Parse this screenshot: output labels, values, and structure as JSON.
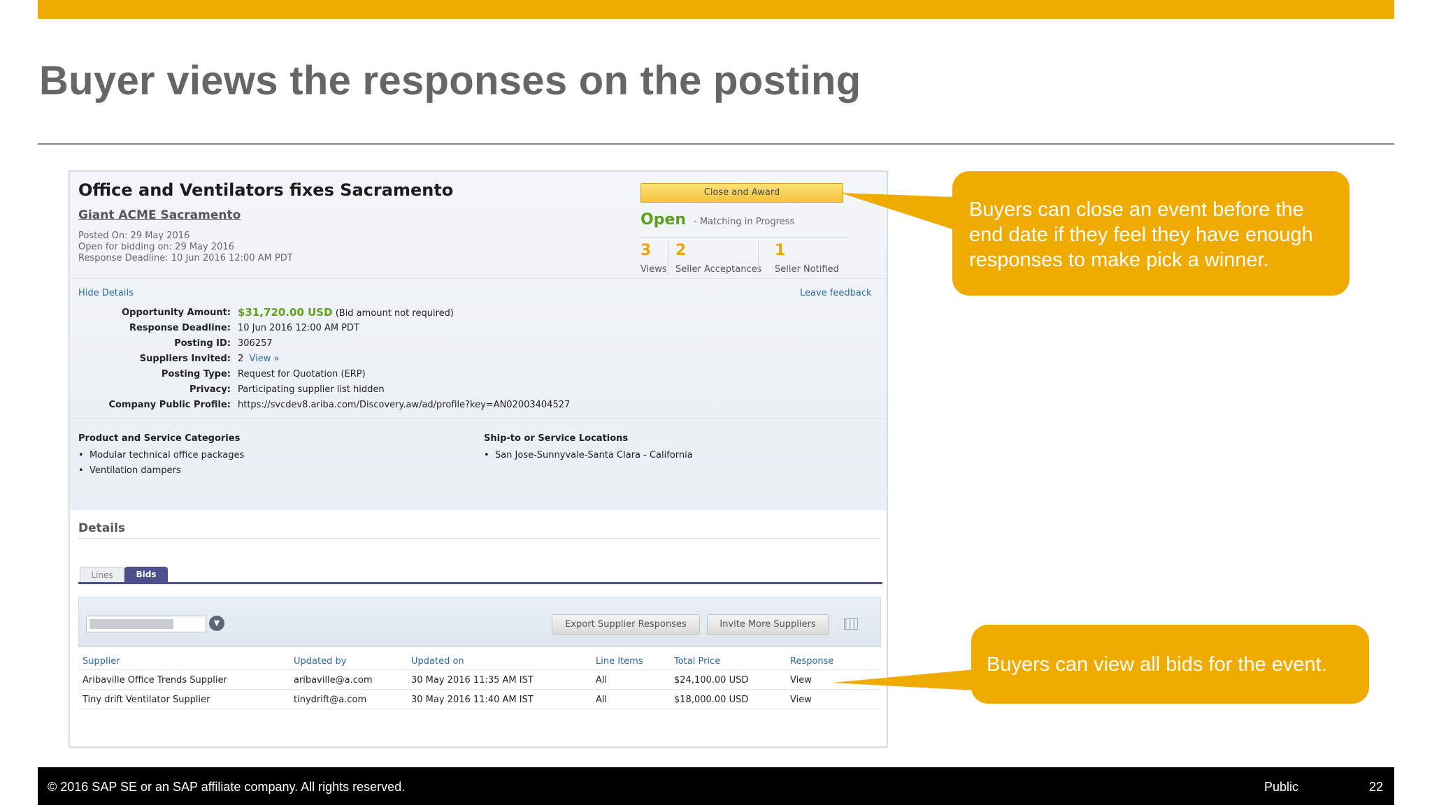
{
  "slide": {
    "title": "Buyer views the responses on the posting",
    "accent_color": "#f0ab00"
  },
  "event": {
    "title": "Office and Ventilators fixes Sacramento",
    "buyer": "Giant ACME Sacramento",
    "posted_on": "Posted On: 29 May 2016",
    "open_for_bidding": "Open for bidding on: 29 May 2016",
    "response_deadline_meta": "Response Deadline: 10 Jun 2016 12:00 AM PDT",
    "close_award_button": "Close and Award",
    "status": "Open",
    "status_sub": "- Matching in Progress",
    "stats": [
      {
        "num": "3",
        "label": "Views"
      },
      {
        "num": "2",
        "label": "Seller Acceptances"
      },
      {
        "num": "1",
        "label": "Seller Notified"
      }
    ],
    "hide_details_link": "Hide Details",
    "leave_feedback_link": "Leave feedback",
    "fields": {
      "opportunity_amount_label": "Opportunity Amount:",
      "opportunity_amount_value": "$31,720.00 USD",
      "opportunity_amount_note": "(Bid amount not required)",
      "response_deadline_label": "Response Deadline:",
      "response_deadline_value": "10 Jun 2016 12:00 AM PDT",
      "posting_id_label": "Posting ID:",
      "posting_id_value": "306257",
      "suppliers_invited_label": "Suppliers Invited:",
      "suppliers_invited_value": "2",
      "suppliers_invited_link": "View »",
      "posting_type_label": "Posting Type:",
      "posting_type_value": "Request for Quotation  (ERP)",
      "privacy_label": "Privacy:",
      "privacy_value": "Participating supplier list hidden",
      "company_profile_label": "Company Public Profile:",
      "company_profile_value": "https://svcdev8.ariba.com/Discovery.aw/ad/profile?key=AN02003404527"
    },
    "categories_heading": "Product and Service Categories",
    "categories": [
      "Modular technical office packages",
      "Ventilation dampers"
    ],
    "locations_heading": "Ship-to or Service Locations",
    "locations": [
      "San Jose-Sunnyvale-Santa Clara - California"
    ]
  },
  "details": {
    "heading": "Details",
    "tabs": [
      "Lines",
      "Bids"
    ],
    "active_tab": "Bids",
    "export_button": "Export Supplier Responses",
    "invite_button": "Invite More Suppliers",
    "columns": [
      "Supplier",
      "Updated by",
      "Updated on",
      "Line Items",
      "Total Price",
      "Response"
    ],
    "rows": [
      {
        "supplier": "Aribaville Office Trends Supplier",
        "updated_by": "aribaville@a.com",
        "updated_on": "30 May 2016 11:35 AM IST",
        "line_items": "All",
        "total_price": "$24,100.00 USD",
        "response": "View"
      },
      {
        "supplier": "Tiny drift Ventilator Supplier",
        "updated_by": "tinydrift@a.com",
        "updated_on": "30 May 2016 11:40 AM IST",
        "line_items": "All",
        "total_price": "$18,000.00 USD",
        "response": "View"
      }
    ]
  },
  "callouts": [
    "Buyers can close an event before the end date if they feel they have enough responses to make pick a winner.",
    "Buyers can view all bids for the event."
  ],
  "footer": {
    "copyright": "© 2016 SAP SE or an SAP affiliate company. All rights reserved.",
    "classification": "Public",
    "page_number": "22"
  }
}
